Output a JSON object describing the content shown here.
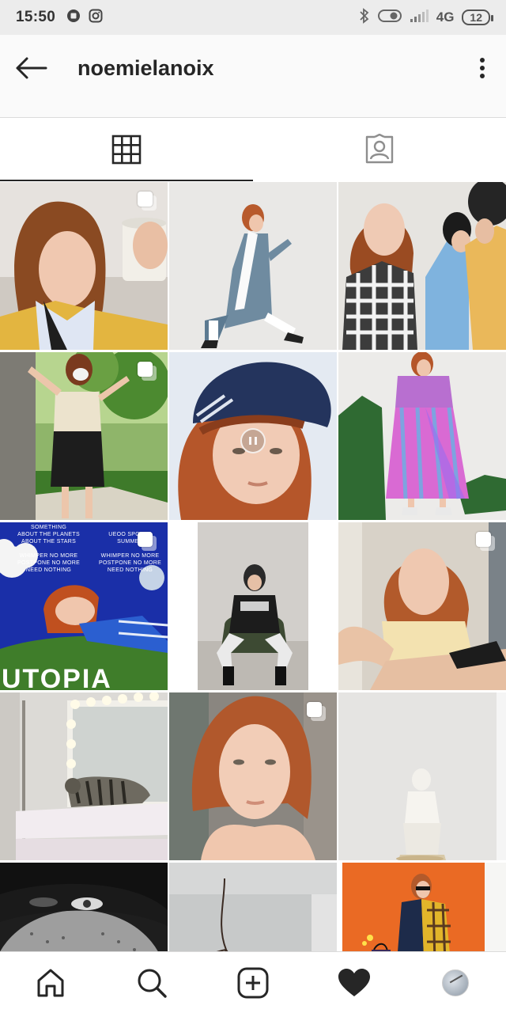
{
  "status_bar": {
    "time": "15:50",
    "network": "4G",
    "battery": "12"
  },
  "header": {
    "username": "noemielanoix"
  },
  "tabs": [
    {
      "name": "grid-tab",
      "icon": "grid-icon",
      "active": true
    },
    {
      "name": "tagged-tab",
      "icon": "tagged-person-icon",
      "active": false
    }
  ],
  "poster": {
    "lines_left": [
      "SOMETHING",
      "ABOUT THE PLANETS",
      "ABOUT THE STARS",
      "",
      "WHIMPER NO MORE",
      "POSTPONE NO MORE",
      "NEED NOTHING"
    ],
    "lines_right": [
      "UEOO SPORTS",
      "SUMMER",
      "",
      "WHIMPER NO MORE",
      "POSTPONE NO MORE",
      "NEED NOTHING"
    ],
    "big_title": "UTOPIA"
  },
  "grid_posts": [
    {
      "id": 1,
      "multi": true,
      "video": false
    },
    {
      "id": 2,
      "multi": false,
      "video": false
    },
    {
      "id": 3,
      "multi": false,
      "video": false
    },
    {
      "id": 4,
      "multi": true,
      "video": false
    },
    {
      "id": 5,
      "multi": false,
      "video": true
    },
    {
      "id": 6,
      "multi": false,
      "video": false
    },
    {
      "id": 7,
      "multi": true,
      "video": false
    },
    {
      "id": 8,
      "multi": false,
      "video": false
    },
    {
      "id": 9,
      "multi": true,
      "video": false
    },
    {
      "id": 10,
      "multi": false,
      "video": false
    },
    {
      "id": 11,
      "multi": true,
      "video": false
    },
    {
      "id": 12,
      "multi": false,
      "video": false
    },
    {
      "id": 13,
      "multi": false,
      "video": false
    },
    {
      "id": 14,
      "multi": false,
      "video": false
    },
    {
      "id": 15,
      "multi": false,
      "video": false
    }
  ],
  "bottom_nav": [
    "home-icon",
    "search-icon",
    "new-post-icon",
    "activity-heart-icon",
    "profile-avatar"
  ],
  "colors": {
    "accent": "#262626",
    "divider": "#dbdbdb",
    "status_bar_bg": "#ececec"
  }
}
